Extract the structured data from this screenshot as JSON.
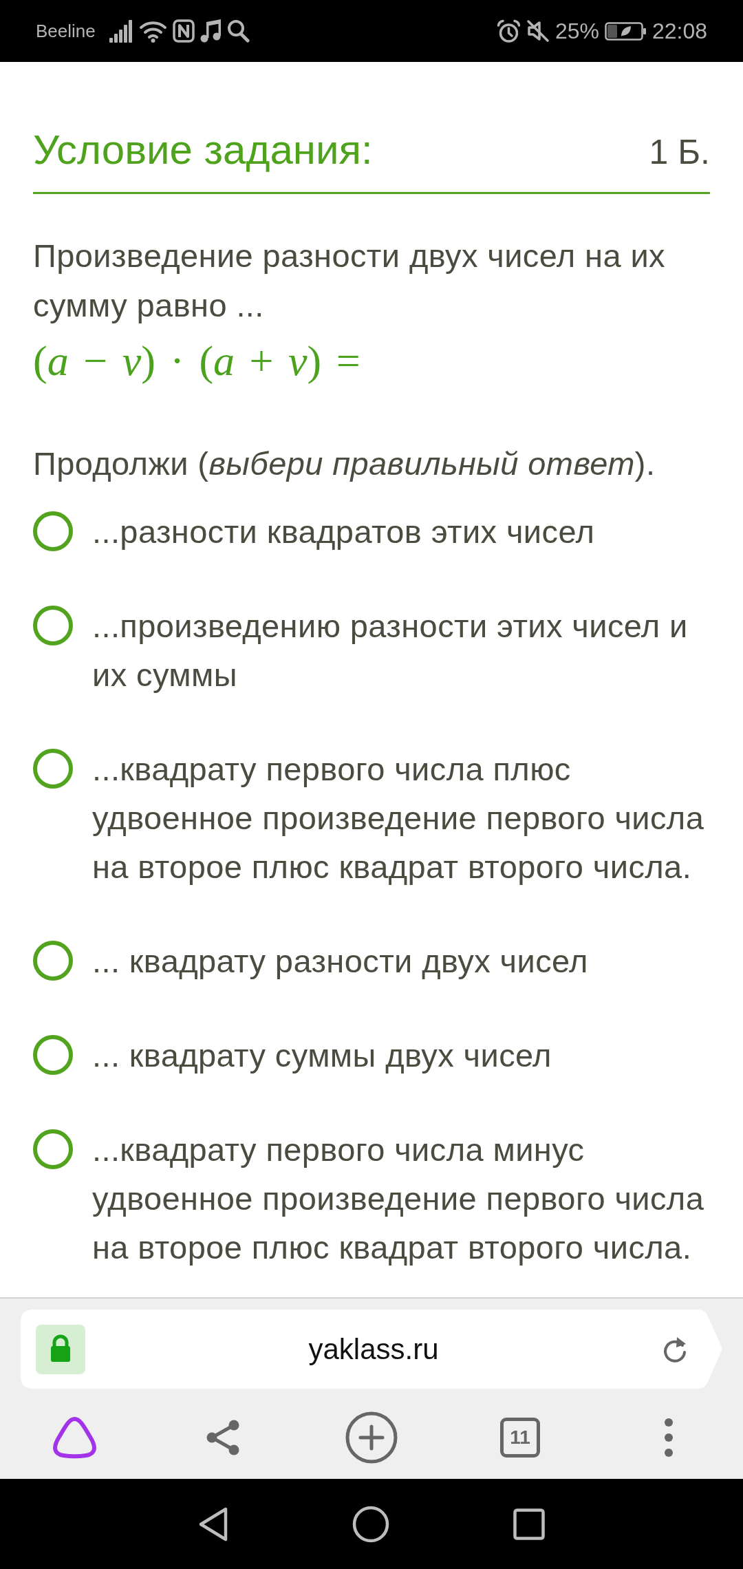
{
  "status_bar": {
    "carrier": "Beeline",
    "battery": "25%",
    "time": "22:08"
  },
  "task": {
    "title": "Условие задания:",
    "points": "1 Б.",
    "question": "Произведение разности двух чисел на их сумму равно ...",
    "formula": "(*a* − *v*) · (*a* + *v*) =",
    "instruction": "Продолжи (*выбери правильный ответ*).",
    "options": [
      {
        "text": "...разности квадратов этих чисел",
        "selected": false
      },
      {
        "text": "...произведению разности этих чисел и их суммы",
        "selected": false
      },
      {
        "text": "...квадрату первого числа плюс удвоенное произведение первого числа на второе плюс квадрат второго числа.",
        "selected": false
      },
      {
        "text": "... квадрату разности двух чисел",
        "selected": false
      },
      {
        "text": "... квадрату суммы двух чисел",
        "selected": false
      },
      {
        "text": "...квадрату первого числа минус удвоенное произведение первого числа на второе плюс квадрат второго числа.",
        "selected": false
      }
    ]
  },
  "browser": {
    "address": "yaklass.ru",
    "tab_count": "11"
  }
}
